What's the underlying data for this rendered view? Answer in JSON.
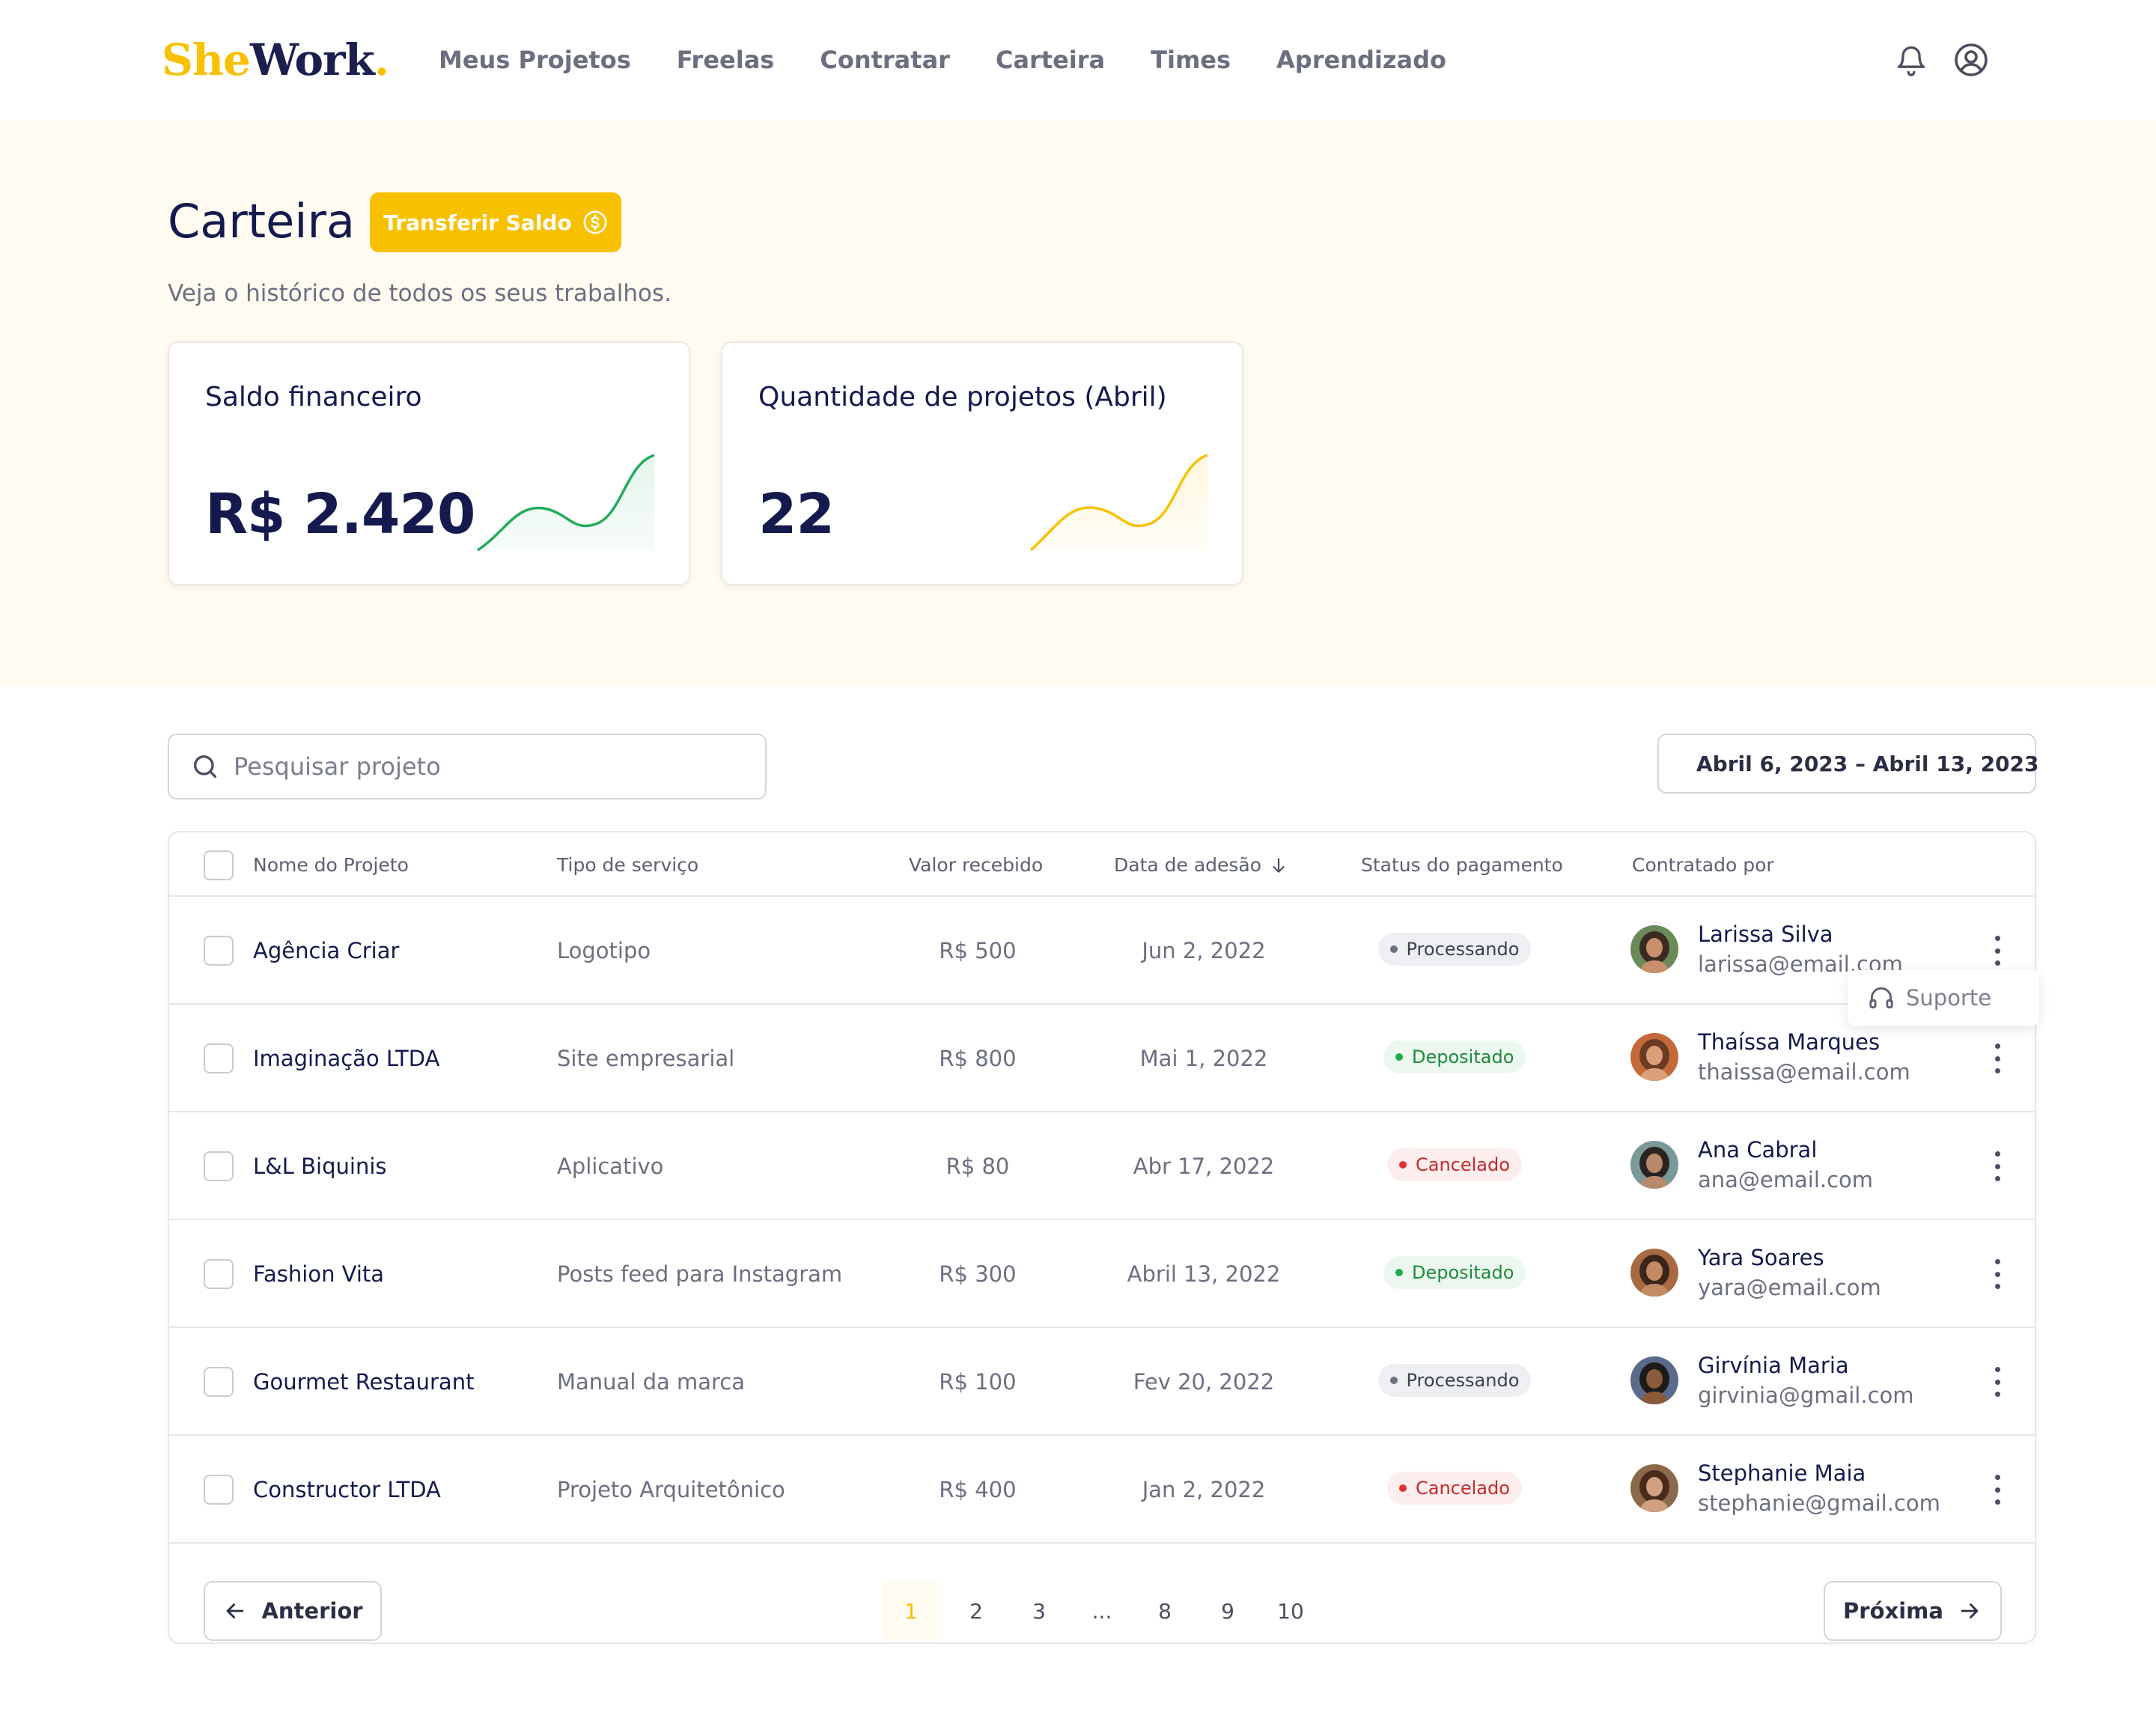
{
  "header": {
    "logo_she": "She",
    "logo_work": "Work",
    "logo_dot": ".",
    "nav": [
      "Meus Projetos",
      "Freelas",
      "Contratar",
      "Carteira",
      "Times",
      "Aprendizado"
    ],
    "icons": [
      "bell-icon",
      "user-circle-icon"
    ]
  },
  "page": {
    "title": "Carteira",
    "transfer_label": "Transferir Saldo",
    "subtitle": "Veja o histórico de todos os seus trabalhos."
  },
  "cards": [
    {
      "title": "Saldo financeiro",
      "value": "R$ 2.420",
      "trend_color": "#22ab5c"
    },
    {
      "title": "Quantidade de projetos (Abril)",
      "value": "22",
      "trend_color": "#f7c100"
    }
  ],
  "search": {
    "placeholder": "Pesquisar projeto"
  },
  "date_range": {
    "label": "Abril 6, 2023 – Abril 13, 2023"
  },
  "table": {
    "columns": [
      "Nome do Projeto",
      "Tipo de serviço",
      "Valor recebido",
      "Data de adesão",
      "Status do pagamento",
      "Contratado por"
    ],
    "rows": [
      {
        "name": "Agência Criar",
        "type": "Logotipo",
        "value": "R$ 500",
        "date": "Jun 2, 2022",
        "status": "Processando",
        "status_kind": "proc",
        "person": "Larissa Silva",
        "email": "larissa@email.com"
      },
      {
        "name": "Imaginação LTDA",
        "type": "Site empresarial",
        "value": "R$ 800",
        "date": "Mai 1, 2022",
        "status": "Depositado",
        "status_kind": "dep",
        "person": "Thaíssa Marques",
        "email": "thaissa@email.com"
      },
      {
        "name": "L&L Biquinis",
        "type": "Aplicativo",
        "value": "R$ 80",
        "date": "Abr 17, 2022",
        "status": "Cancelado",
        "status_kind": "can",
        "person": "Ana Cabral",
        "email": "ana@email.com"
      },
      {
        "name": "Fashion Vita",
        "type": "Posts feed para Instagram",
        "value": "R$ 300",
        "date": "Abril 13, 2022",
        "status": "Depositado",
        "status_kind": "dep",
        "person": "Yara Soares",
        "email": "yara@email.com"
      },
      {
        "name": "Gourmet Restaurant",
        "type": "Manual da marca",
        "value": "R$ 100",
        "date": "Fev 20, 2022",
        "status": "Processando",
        "status_kind": "proc",
        "person": "Girvínia Maria",
        "email": "girvinia@gmail.com"
      },
      {
        "name": "Constructor LTDA",
        "type": "Projeto Arquitetônico",
        "value": "R$ 400",
        "date": "Jan 2, 2022",
        "status": "Cancelado",
        "status_kind": "can",
        "person": "Stephanie Maia",
        "email": "stephanie@gmail.com"
      }
    ]
  },
  "tooltip": {
    "label": "Suporte"
  },
  "pagination": {
    "prev": "Anterior",
    "next": "Próxima",
    "pages": [
      "1",
      "2",
      "3",
      "...",
      "8",
      "9",
      "10"
    ],
    "current": "1"
  },
  "colors": {
    "brand": "#f7c100",
    "navy": "#141a4d",
    "hero_bg": "#fffbf1"
  }
}
